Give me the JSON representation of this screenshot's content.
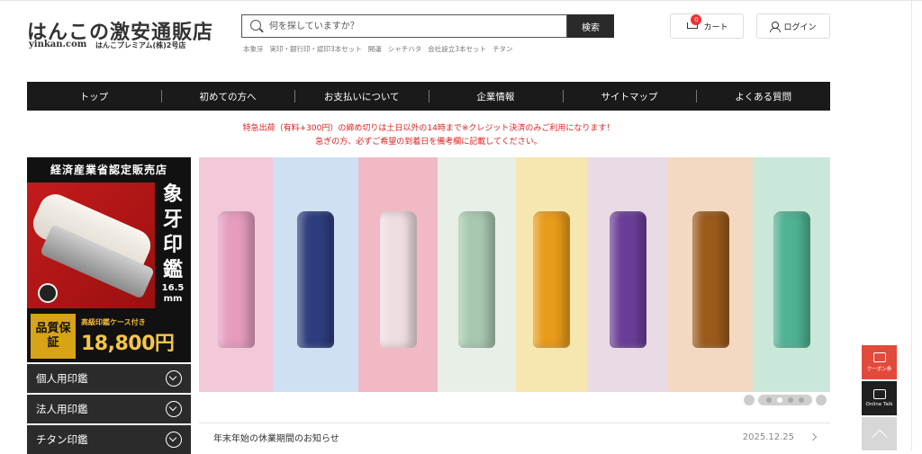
{
  "header": {
    "logo_title": "はんこの激安通販店",
    "logo_domain": "yinkan.com",
    "logo_sub": "はんこプレミアム(株)2号店",
    "search_placeholder": "何を探していますか？",
    "search_button": "検索",
    "keywords": [
      "本象牙",
      "実印・銀行印・認印3本セット",
      "開運",
      "シャチハタ",
      "会社設立3本セット",
      "チタン"
    ],
    "cart_label": "カート",
    "cart_count": "0",
    "login_label": "ログイン",
    "icons": {
      "search": "search-icon",
      "cart": "cart-icon",
      "login": "user-icon"
    }
  },
  "nav": {
    "items": [
      "トップ",
      "初めての方へ",
      "お支払いについて",
      "企業情報",
      "サイトマップ",
      "よくある質問"
    ]
  },
  "notice": {
    "line1": "特急出荷（有料+300円）の締め切りは土日以外の14時まで※クレジット決済のみご利用になります！",
    "line2": "急ぎの方、必ずご希望の到着日を備考欄に記載してください。",
    "color": "#e02020"
  },
  "side_banner": {
    "heading": "経済産業省認定販売店",
    "vertical_text": "象牙印鑑",
    "size_text": "16.5 mm",
    "quality_badge": "品質保証",
    "case_note": "高級印鑑ケース付き",
    "price": "18,800円"
  },
  "side_menu": {
    "items": [
      "個人用印鑑",
      "法人用印鑑",
      "チタン印鑑"
    ]
  },
  "hero": {
    "panels": [
      {
        "bg": "#f3c9d9",
        "stone": "#e69cbf"
      },
      {
        "bg": "#cfe0f3",
        "stone": "#2e3d7e"
      },
      {
        "bg": "#f1b9c4",
        "stone": "#f0dde1"
      },
      {
        "bg": "#e7efe6",
        "stone": "#a8c9b0"
      },
      {
        "bg": "#f6e7b0",
        "stone": "#e99b1a"
      },
      {
        "bg": "#eadae6",
        "stone": "#6a3e98"
      },
      {
        "bg": "#f3d8c2",
        "stone": "#9c5a1b"
      },
      {
        "bg": "#c9e8da",
        "stone": "#4fb293"
      }
    ]
  },
  "news": {
    "title": "年末年始の休業期間のお知らせ",
    "date": "2025.12.25"
  },
  "floating": {
    "coupon_label": "クーポン券",
    "online_label": "Online Talk"
  }
}
